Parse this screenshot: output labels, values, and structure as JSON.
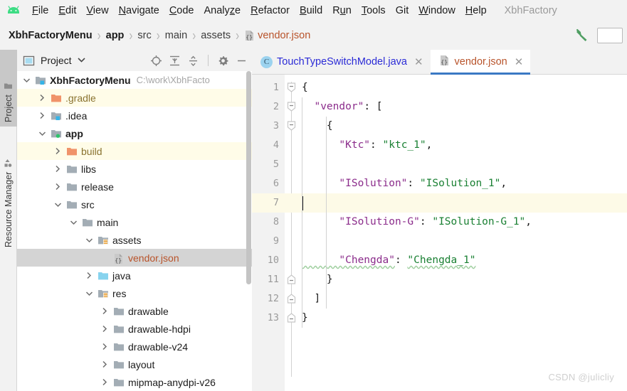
{
  "app": {
    "logo_icon": "android-studio-logo-icon",
    "project_name": "XbhFactory"
  },
  "menubar": {
    "items": [
      {
        "pre": "",
        "mnemonic": "F",
        "post": "ile"
      },
      {
        "pre": "",
        "mnemonic": "E",
        "post": "dit"
      },
      {
        "pre": "",
        "mnemonic": "V",
        "post": "iew"
      },
      {
        "pre": "",
        "mnemonic": "N",
        "post": "avigate"
      },
      {
        "pre": "",
        "mnemonic": "C",
        "post": "ode"
      },
      {
        "pre": "Analy",
        "mnemonic": "z",
        "post": "e"
      },
      {
        "pre": "",
        "mnemonic": "R",
        "post": "efactor"
      },
      {
        "pre": "",
        "mnemonic": "B",
        "post": "uild"
      },
      {
        "pre": "R",
        "mnemonic": "u",
        "post": "n"
      },
      {
        "pre": "",
        "mnemonic": "T",
        "post": "ools"
      },
      {
        "pre": "Git",
        "mnemonic": "",
        "post": ""
      },
      {
        "pre": "",
        "mnemonic": "W",
        "post": "indow"
      },
      {
        "pre": "",
        "mnemonic": "H",
        "post": "elp"
      }
    ]
  },
  "breadcrumb": {
    "items": [
      {
        "label": "XbhFactoryMenu",
        "style": "bold"
      },
      {
        "label": "app",
        "style": "bold"
      },
      {
        "label": "src",
        "style": "normal"
      },
      {
        "label": "main",
        "style": "normal"
      },
      {
        "label": "assets",
        "style": "normal"
      },
      {
        "label": "vendor.json",
        "style": "file",
        "icon": "json-file-icon"
      }
    ],
    "separator": "›",
    "build_icon": "hammer-build-icon",
    "search_placeholder": ""
  },
  "left_toolwindow_bar": {
    "tabs": [
      {
        "label": "Project",
        "icon": "project-folder-icon",
        "active": true
      },
      {
        "label": "Resource Manager",
        "icon": "resource-manager-icon",
        "active": false
      }
    ]
  },
  "project_panel": {
    "title": "Project",
    "title_icon": "project-view-icon",
    "dropdown_icon": "chevron-down-icon",
    "toolbar_icons": [
      "locate-target-icon",
      "expand-all-icon",
      "collapse-all-icon",
      "settings-gear-icon",
      "hide-panel-icon"
    ],
    "tree": [
      {
        "depth": 0,
        "arrow": "expanded",
        "label": "XbhFactoryMenu",
        "bold": true,
        "icon": "module-folder-icon",
        "badge": "blue",
        "hint": "C:\\work\\XbhFacto",
        "state": "normal"
      },
      {
        "depth": 1,
        "arrow": "collapsed",
        "label": ".gradle",
        "bold": false,
        "icon": "excluded-folder-icon",
        "badge": "none",
        "hint": "",
        "state": "excluded"
      },
      {
        "depth": 1,
        "arrow": "collapsed",
        "label": ".idea",
        "bold": false,
        "icon": "module-folder-icon",
        "badge": "blue",
        "hint": "",
        "state": "normal"
      },
      {
        "depth": 1,
        "arrow": "expanded",
        "label": "app",
        "bold": true,
        "icon": "module-folder-icon",
        "badge": "green",
        "hint": "",
        "state": "normal"
      },
      {
        "depth": 2,
        "arrow": "collapsed",
        "label": "build",
        "bold": false,
        "icon": "excluded-folder-icon",
        "badge": "none",
        "hint": "",
        "state": "excluded"
      },
      {
        "depth": 2,
        "arrow": "collapsed",
        "label": "libs",
        "bold": false,
        "icon": "plain-folder-icon",
        "badge": "none",
        "hint": "",
        "state": "normal"
      },
      {
        "depth": 2,
        "arrow": "collapsed",
        "label": "release",
        "bold": false,
        "icon": "plain-folder-icon",
        "badge": "none",
        "hint": "",
        "state": "normal"
      },
      {
        "depth": 2,
        "arrow": "expanded",
        "label": "src",
        "bold": false,
        "icon": "plain-folder-icon",
        "badge": "none",
        "hint": "",
        "state": "normal"
      },
      {
        "depth": 3,
        "arrow": "expanded",
        "label": "main",
        "bold": false,
        "icon": "plain-folder-icon",
        "badge": "none",
        "hint": "",
        "state": "normal"
      },
      {
        "depth": 4,
        "arrow": "expanded",
        "label": "assets",
        "bold": false,
        "icon": "assets-folder-icon",
        "badge": "lines",
        "hint": "",
        "state": "normal"
      },
      {
        "depth": 5,
        "arrow": "none",
        "label": "vendor.json",
        "bold": false,
        "icon": "json-file-icon",
        "badge": "none",
        "hint": "",
        "state": "selected"
      },
      {
        "depth": 4,
        "arrow": "collapsed",
        "label": "java",
        "bold": false,
        "icon": "source-folder-icon",
        "badge": "none",
        "hint": "",
        "state": "normal"
      },
      {
        "depth": 4,
        "arrow": "expanded",
        "label": "res",
        "bold": false,
        "icon": "assets-folder-icon",
        "badge": "lines",
        "hint": "",
        "state": "normal"
      },
      {
        "depth": 5,
        "arrow": "collapsed",
        "label": "drawable",
        "bold": false,
        "icon": "plain-folder-icon",
        "badge": "none",
        "hint": "",
        "state": "normal"
      },
      {
        "depth": 5,
        "arrow": "collapsed",
        "label": "drawable-hdpi",
        "bold": false,
        "icon": "plain-folder-icon",
        "badge": "none",
        "hint": "",
        "state": "normal"
      },
      {
        "depth": 5,
        "arrow": "collapsed",
        "label": "drawable-v24",
        "bold": false,
        "icon": "plain-folder-icon",
        "badge": "none",
        "hint": "",
        "state": "normal"
      },
      {
        "depth": 5,
        "arrow": "collapsed",
        "label": "layout",
        "bold": false,
        "icon": "plain-folder-icon",
        "badge": "none",
        "hint": "",
        "state": "normal"
      },
      {
        "depth": 5,
        "arrow": "collapsed",
        "label": "mipmap-anydpi-v26",
        "bold": false,
        "icon": "plain-folder-icon",
        "badge": "none",
        "hint": "",
        "state": "normal"
      }
    ]
  },
  "editor": {
    "tabs": [
      {
        "label": "TouchTypeSwitchModel.java",
        "icon": "java-class-icon",
        "kind": "java",
        "active": false,
        "close_icon": "close-icon"
      },
      {
        "label": "vendor.json",
        "icon": "json-file-icon",
        "kind": "json",
        "active": true,
        "close_icon": "close-icon"
      }
    ],
    "current_line": 7,
    "lines": [
      {
        "n": 1,
        "fold": "open",
        "indent": 0,
        "tokens": [
          {
            "t": "{",
            "c": "punct"
          }
        ]
      },
      {
        "n": 2,
        "fold": "open",
        "indent": 1,
        "tokens": [
          {
            "t": "  \"vendor\"",
            "c": "key"
          },
          {
            "t": ": ",
            "c": "punct"
          },
          {
            "t": "[",
            "c": "punct"
          }
        ]
      },
      {
        "n": 3,
        "fold": "open",
        "indent": 2,
        "tokens": [
          {
            "t": "    {",
            "c": "punct"
          }
        ]
      },
      {
        "n": 4,
        "fold": "none",
        "indent": 3,
        "tokens": [
          {
            "t": "      \"Ktc\"",
            "c": "key"
          },
          {
            "t": ": ",
            "c": "punct"
          },
          {
            "t": "\"ktc_1\"",
            "c": "str"
          },
          {
            "t": ",",
            "c": "punct"
          }
        ]
      },
      {
        "n": 5,
        "fold": "none",
        "indent": 3,
        "tokens": []
      },
      {
        "n": 6,
        "fold": "none",
        "indent": 3,
        "tokens": [
          {
            "t": "      \"ISolution\"",
            "c": "key"
          },
          {
            "t": ": ",
            "c": "punct"
          },
          {
            "t": "\"ISolution_1\"",
            "c": "str"
          },
          {
            "t": ",",
            "c": "punct"
          }
        ]
      },
      {
        "n": 7,
        "fold": "none",
        "indent": 3,
        "tokens": []
      },
      {
        "n": 8,
        "fold": "none",
        "indent": 3,
        "tokens": [
          {
            "t": "      \"ISolution-G\"",
            "c": "key"
          },
          {
            "t": ": ",
            "c": "punct"
          },
          {
            "t": "\"ISolution-G_1\"",
            "c": "str"
          },
          {
            "t": ",",
            "c": "punct"
          }
        ]
      },
      {
        "n": 9,
        "fold": "none",
        "indent": 3,
        "tokens": []
      },
      {
        "n": 10,
        "fold": "none",
        "indent": 3,
        "tokens": [
          {
            "t": "      \"Chengda\"",
            "c": "key-spell"
          },
          {
            "t": ": ",
            "c": "punct"
          },
          {
            "t": "\"Chengda_1\"",
            "c": "str-spell"
          }
        ]
      },
      {
        "n": 11,
        "fold": "close",
        "indent": 2,
        "tokens": [
          {
            "t": "    }",
            "c": "punct"
          }
        ]
      },
      {
        "n": 12,
        "fold": "close",
        "indent": 1,
        "tokens": [
          {
            "t": "  ]",
            "c": "punct"
          }
        ]
      },
      {
        "n": 13,
        "fold": "close",
        "indent": 0,
        "tokens": [
          {
            "t": "}",
            "c": "punct"
          }
        ]
      }
    ]
  },
  "watermark": {
    "text": "CSDN @julicliy"
  },
  "colors": {
    "accent_tab_underline": "#3b79c4",
    "json_key": "#8b2c8b",
    "json_string": "#1a8033",
    "file_name": "#b8532a",
    "excluded_row_bg": "#fffce8",
    "selected_row_bg": "#d4d4d4",
    "current_line_bg": "#fdfae7",
    "chrome_bg": "#f2f2f2",
    "android_green": "#3ddc84"
  }
}
